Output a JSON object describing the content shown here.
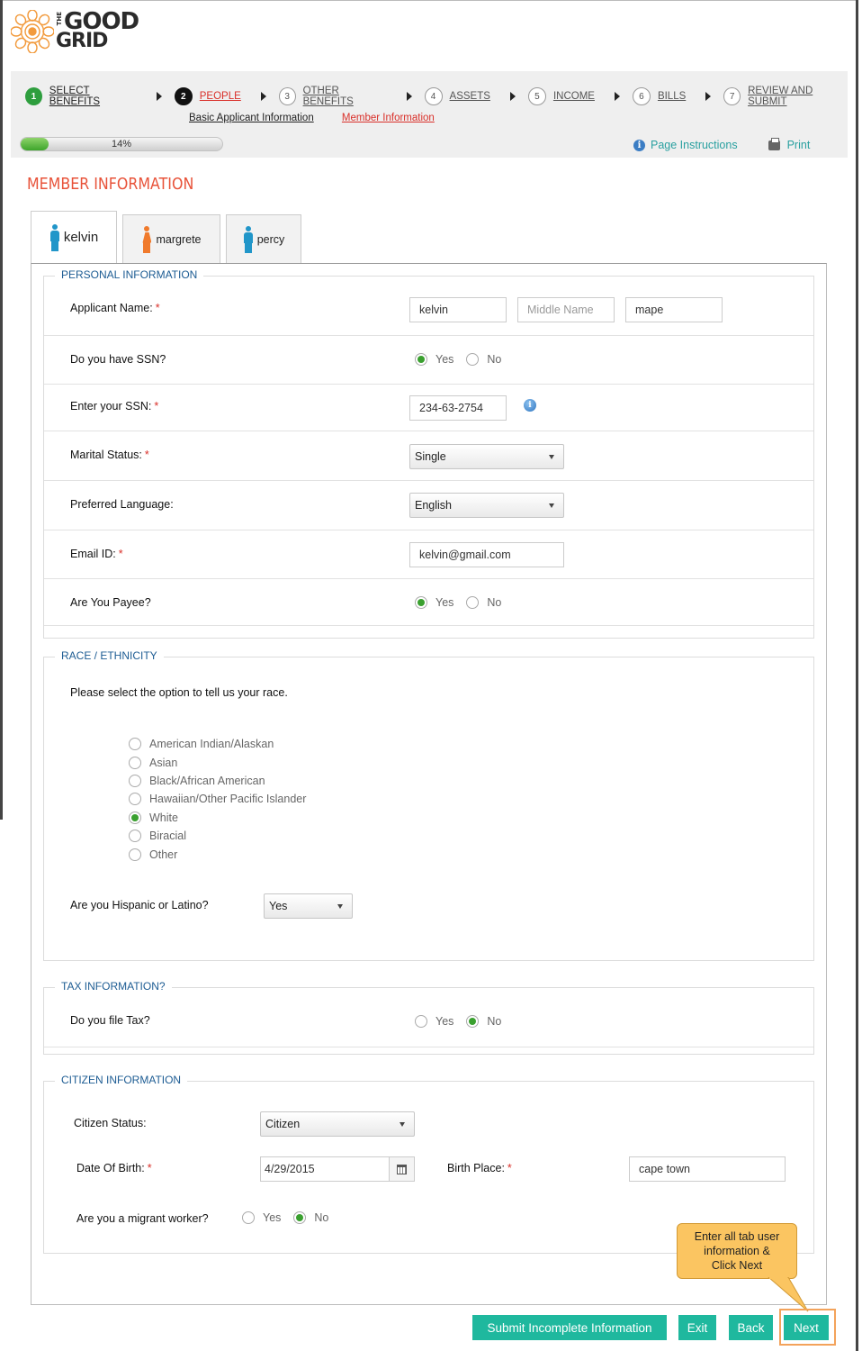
{
  "logo": {
    "line1_prefix": "THE",
    "line1": "GOOD",
    "line2": "GRID"
  },
  "wizard": {
    "steps": [
      {
        "num": "1",
        "label": "SELECT BENEFITS",
        "state": "done"
      },
      {
        "num": "2",
        "label": "PEOPLE",
        "state": "current"
      },
      {
        "num": "3",
        "label": "OTHER BENEFITS",
        "state": "todo"
      },
      {
        "num": "4",
        "label": "ASSETS",
        "state": "todo"
      },
      {
        "num": "5",
        "label": "INCOME",
        "state": "todo"
      },
      {
        "num": "6",
        "label": "BILLS",
        "state": "todo"
      },
      {
        "num": "7",
        "label": "REVIEW AND SUBMIT",
        "state": "todo"
      }
    ],
    "substeps": [
      "Basic Applicant Information",
      "Member Information"
    ],
    "active_substep": 1,
    "progress_percent": 14,
    "progress_text": "14%",
    "page_instructions": "Page Instructions",
    "print": "Print"
  },
  "page_title": "MEMBER INFORMATION",
  "tabs": [
    {
      "name": "kelvin",
      "gender": "male",
      "active": true
    },
    {
      "name": "margrete",
      "gender": "female",
      "active": false
    },
    {
      "name": "percy",
      "gender": "male",
      "active": false
    }
  ],
  "personal": {
    "legend": "PERSONAL INFORMATION",
    "applicant_name_label": "Applicant Name:",
    "first_name": "kelvin",
    "middle_name_placeholder": "Middle Name",
    "last_name": "mape",
    "ssn_question": "Do you have SSN?",
    "yes": "Yes",
    "no": "No",
    "ssn_label": "Enter your SSN:",
    "ssn_value": "234-63-2754",
    "marital_label": "Marital Status:",
    "marital_value": "Single",
    "language_label": "Preferred Language:",
    "language_value": "English",
    "email_label": "Email ID:",
    "email_value": "kelvin@gmail.com",
    "payee_label": "Are You Payee?"
  },
  "race": {
    "legend": "RACE / ETHNICITY",
    "prompt": "Please select the option to tell us your race.",
    "options": [
      "American Indian/Alaskan",
      "Asian",
      "Black/African American",
      "Hawaiian/Other Pacific Islander",
      "White",
      "Biracial",
      "Other"
    ],
    "selected": "White",
    "hispanic_label": "Are you Hispanic or Latino?",
    "hispanic_value": "Yes"
  },
  "tax": {
    "legend": "TAX INFORMATION?",
    "question": "Do you file Tax?",
    "yes": "Yes",
    "no": "No"
  },
  "citizen": {
    "legend": "CITIZEN INFORMATION",
    "status_label": "Citizen Status:",
    "status_value": "Citizen",
    "dob_label": "Date Of Birth:",
    "dob_value": "4/29/2015",
    "birthplace_label": "Birth Place:",
    "birthplace_value": "cape town",
    "migrant_label": "Are you a migrant worker?",
    "yes": "Yes",
    "no": "No"
  },
  "callout": {
    "line1": "Enter all tab user",
    "line2": "information &",
    "line3": "Click Next"
  },
  "buttons": {
    "submit_incomplete": "Submit Incomplete Information",
    "exit": "Exit",
    "back": "Back",
    "next": "Next"
  },
  "colors": {
    "accent_teal": "#1fb89e",
    "title_orange": "#e8533a",
    "legend_blue": "#1d5c93",
    "radio_green": "#3aa02f",
    "callout_yellow": "#fbc561"
  }
}
